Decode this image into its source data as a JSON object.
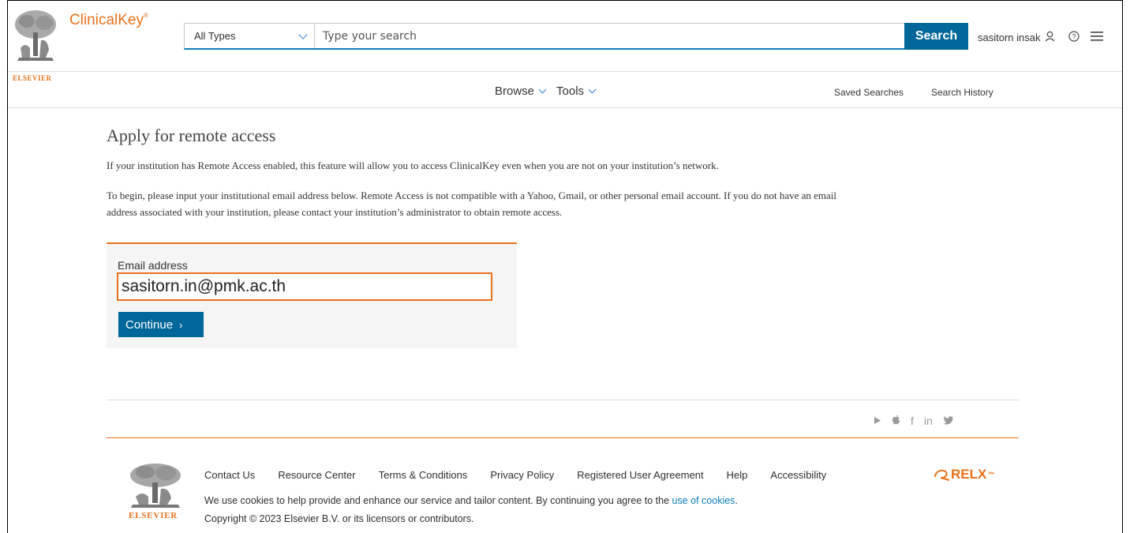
{
  "header": {
    "brand_name": "ClinicalKey",
    "brand_mark": "®",
    "publisher": "ELSEVIER",
    "search_type": "All Types",
    "search_placeholder": "Type your search",
    "search_button": "Search",
    "user_name": "sasitorn insak",
    "icons": [
      "user-icon",
      "help-icon",
      "hamburger-menu-icon"
    ]
  },
  "nav": {
    "browse": "Browse",
    "tools": "Tools",
    "saved_searches": "Saved Searches",
    "search_history": "Search History"
  },
  "main": {
    "title": "Apply for remote access",
    "para1": "If your institution has Remote Access enabled, this feature will allow you to access ClinicalKey even when you are not on your institution’s network.",
    "para2_line1": "To begin, please input your institutional email address below. Remote Access is not compatible with a Yahoo, Gmail, or other personal email account. If you do not have an email",
    "para2_line2": "address associated with your institution, please contact your institution’s administrator to obtain remote access.",
    "email_label": "Email address",
    "email_value": "sasitorn.in@pmk.ac.th",
    "continue_label": "Continue",
    "continue_arrow": "›"
  },
  "footer": {
    "links": [
      "Contact Us",
      "Resource Center",
      "Terms & Conditions",
      "Privacy Policy",
      "Registered User Agreement",
      "Help",
      "Accessibility"
    ],
    "cookie_text": "We use cookies to help provide and enhance our service and tailor content. By continuing you agree to the ",
    "cookie_link": "use of cookies",
    "cookie_end": ".",
    "copyright": "Copyright © 2023 Elsevier B.V. or its licensors or contributors.",
    "publisher": "ELSEVIER",
    "relx": "RELX",
    "relx_mark": "™",
    "social_icons": [
      "youtube-icon",
      "apple-icon",
      "facebook-icon",
      "linkedin-icon",
      "twitter-icon"
    ],
    "social_glyphs": [
      "▶",
      "",
      "f",
      "in",
      "🐦"
    ]
  },
  "colors": {
    "brand_orange": "#e9711c",
    "button_blue": "#00679a",
    "link_blue": "#0c7dbb"
  }
}
